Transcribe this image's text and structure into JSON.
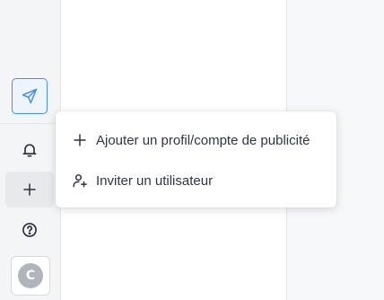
{
  "sidebar": {
    "buttons": [
      {
        "name": "send",
        "icon": "paper-plane-icon",
        "active": true
      },
      {
        "name": "notifications",
        "icon": "bell-icon"
      },
      {
        "name": "add",
        "icon": "plus-icon",
        "highlighted": true
      },
      {
        "name": "help",
        "icon": "question-circle-icon"
      }
    ],
    "avatar": {
      "initial": "C"
    }
  },
  "dropdown": {
    "items": [
      {
        "icon": "plus-icon",
        "label": "Ajouter un profil/compte de publicité"
      },
      {
        "icon": "user-plus-icon",
        "label": "Inviter un utilisateur"
      }
    ]
  },
  "colors": {
    "accent": "#4a90e2",
    "text": "#2f3545",
    "icon": "#2b3142",
    "avatar_bg": "#b0b4bb"
  }
}
